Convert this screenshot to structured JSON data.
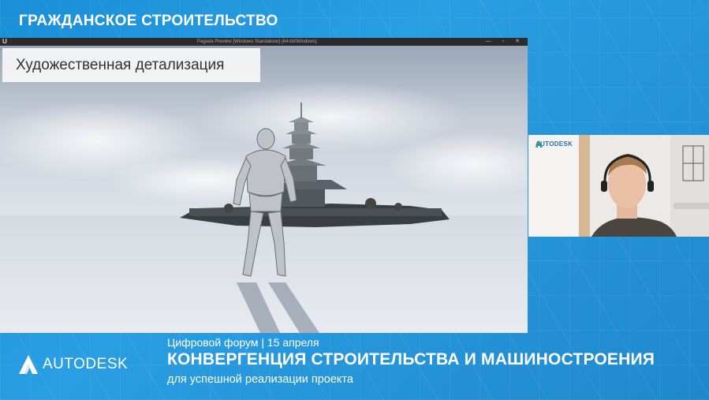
{
  "header": {
    "section_title": "ГРАЖДАНСКОЕ СТРОИТЕЛЬСТВО"
  },
  "main_window": {
    "title_bar_text": "Pagoda Preview [Windows Standalone] (64-bit/Windows)",
    "app_icon": "unreal-engine-icon",
    "slide_label": "Художественная детализация"
  },
  "webcam": {
    "logo_text": "AUTODESK",
    "logo_icon": "autodesk-logo-icon"
  },
  "banner": {
    "brand_text": "AUTODESK",
    "brand_mark": ".",
    "forum_date": "Цифровой форум | 15 апреля",
    "headline": "КОНВЕРГЕНЦИЯ СТРОИТЕЛЬСТВА И МАШИНОСТРОЕНИЯ",
    "subline": "для успешной реализации проекта"
  },
  "colors": {
    "background_blue": "#1f8fd6",
    "banner_text": "#ffffff",
    "slide_label_bg": "#f5f5f5"
  }
}
